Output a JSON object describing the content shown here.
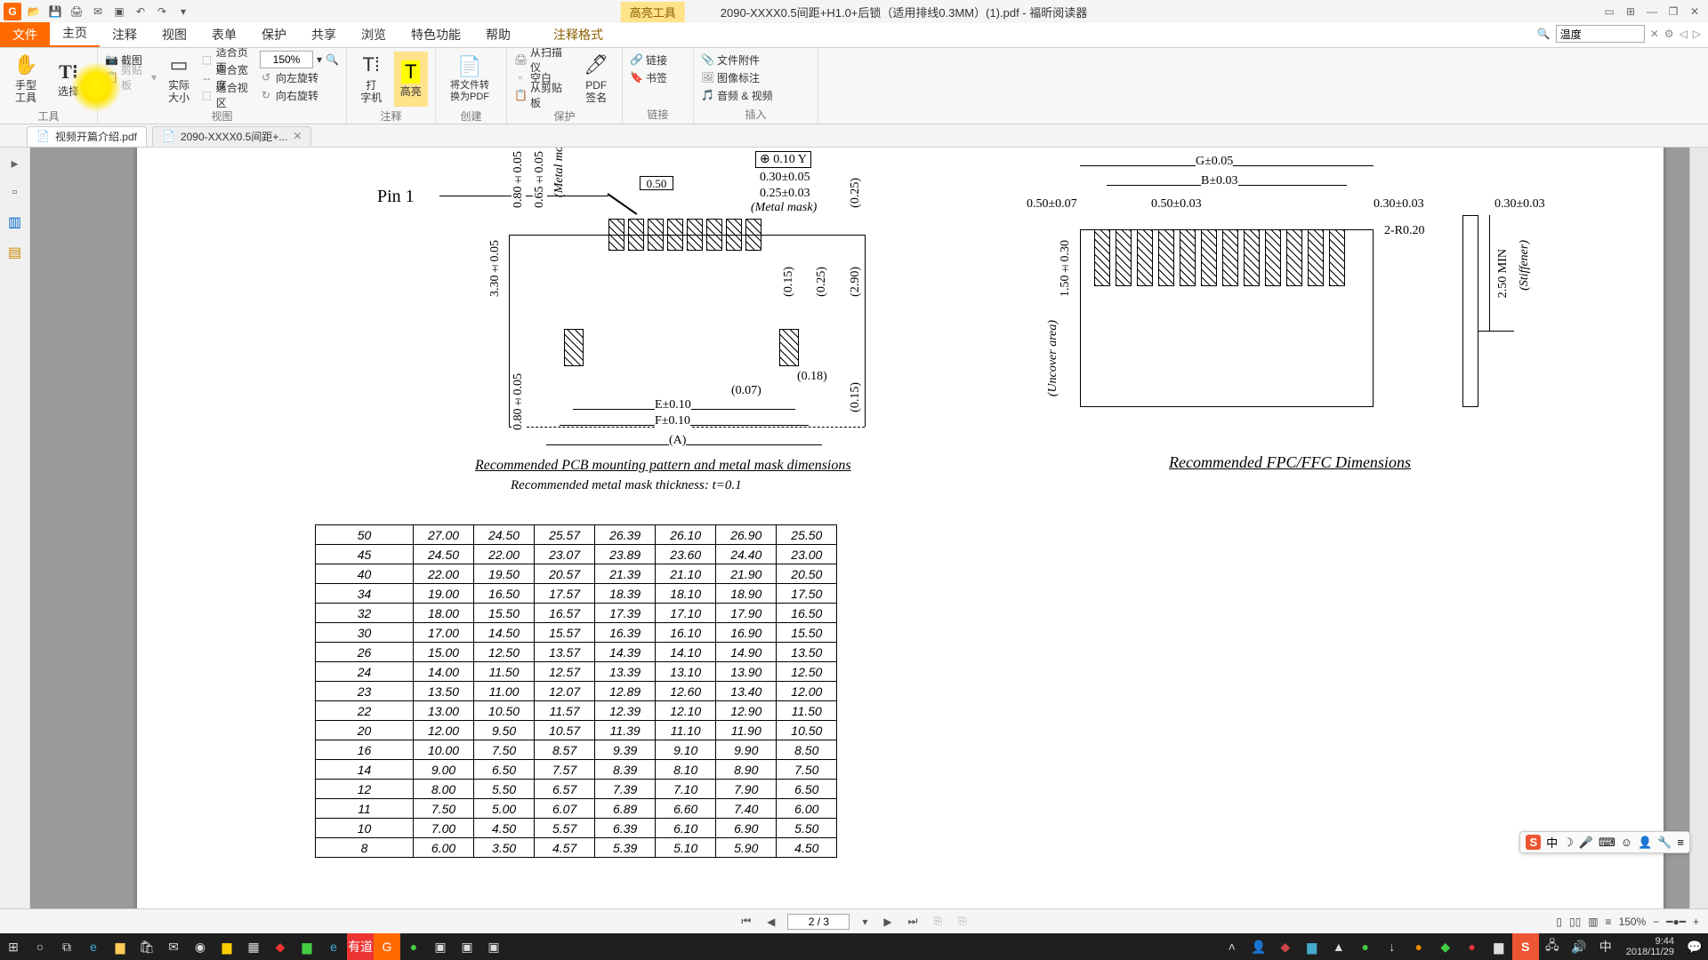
{
  "title": {
    "tool": "高亮工具",
    "doc": "2090-XXXX0.5间距+H1.0+后锁（适用排线0.3MM）(1).pdf - 福昕阅读器"
  },
  "menu": [
    "文件",
    "主页",
    "注释",
    "视图",
    "表单",
    "保护",
    "共享",
    "浏览",
    "特色功能",
    "帮助",
    "注释格式"
  ],
  "search": {
    "placeholder": "温度"
  },
  "ribbon": {
    "tools": {
      "hand": "手型\n工具",
      "select": "选择",
      "group": "工具"
    },
    "clip": {
      "snap": "截图",
      "clipboard": "剪贴板",
      "actual": "实际\n大小"
    },
    "view": {
      "fitpage": "适合页面",
      "fitwidth": "适合宽度",
      "fitview": "适合视区",
      "rotL": "向左旋转",
      "rotR": "向右旋转",
      "zoom": "150%",
      "group": "视图"
    },
    "annot": {
      "typewriter": "打\n字机",
      "highlight": "高亮",
      "group": "注释"
    },
    "create": {
      "convert": "将文件转\n换为PDF",
      "group": "创建"
    },
    "protect": {
      "pdfsign": "PDF\n签名",
      "group": "保护"
    },
    "links": {
      "link": "链接",
      "bookmark": "书签",
      "scan": "从扫描仪",
      "blank": "空白",
      "clip": "从剪贴板",
      "group": "链接"
    },
    "insert": {
      "attach": "文件附件",
      "imgnote": "图像标注",
      "av": "音频 & 视频",
      "group": "插入"
    }
  },
  "doctabs": [
    {
      "label": "视频开篇介绍.pdf"
    },
    {
      "label": "2090-XXXX0.5间距+..."
    }
  ],
  "drawing": {
    "pin1": "Pin 1",
    "d_050": "0.50",
    "d_030_005": "0.30±0.05",
    "d_025_003": "0.25±0.03",
    "metal_mask": "(Metal mask)",
    "metal_mo": "(Metal mo",
    "d_080_005": "0.80±0.05",
    "d_065_005": "0.65±0.05",
    "d_330_005": "3.30±0.05",
    "d_080_005b": "0.80±0.05",
    "d_015": "(0.15)",
    "d_025": "(0.25)",
    "d_290": "(2.90)",
    "d_015b": "(0.15)",
    "d_018": "(0.18)",
    "d_007": "(0.07)",
    "e010": "E±0.10",
    "f010": "F±0.10",
    "a": "(A)",
    "gd": "⊕ 0.10 Y",
    "caption1": "Recommended PCB mounting pattern and metal mask dimensions",
    "caption1b": "Recommended metal mask thickness: t=0.1"
  },
  "drawing2": {
    "g": "G±0.05",
    "b": "B±0.03",
    "d050_007": "0.50±0.07",
    "d050_003": "0.50±0.03",
    "d030_003": "0.30±0.03",
    "d030_003b": "0.30±0.03",
    "r": "2-R0.20",
    "d150": "1.50±0.30",
    "uncover": "(Uncover area)",
    "stiff": "(Stiffener)",
    "d250": "2.50 MIN",
    "caption": "Recommended FPC/FFC Dimensions"
  },
  "table": [
    [
      "50",
      "27.00",
      "24.50",
      "25.57",
      "26.39",
      "26.10",
      "26.90",
      "25.50"
    ],
    [
      "45",
      "24.50",
      "22.00",
      "23.07",
      "23.89",
      "23.60",
      "24.40",
      "23.00"
    ],
    [
      "40",
      "22.00",
      "19.50",
      "20.57",
      "21.39",
      "21.10",
      "21.90",
      "20.50"
    ],
    [
      "34",
      "19.00",
      "16.50",
      "17.57",
      "18.39",
      "18.10",
      "18.90",
      "17.50"
    ],
    [
      "32",
      "18.00",
      "15.50",
      "16.57",
      "17.39",
      "17.10",
      "17.90",
      "16.50"
    ],
    [
      "30",
      "17.00",
      "14.50",
      "15.57",
      "16.39",
      "16.10",
      "16.90",
      "15.50"
    ],
    [
      "26",
      "15.00",
      "12.50",
      "13.57",
      "14.39",
      "14.10",
      "14.90",
      "13.50"
    ],
    [
      "24",
      "14.00",
      "11.50",
      "12.57",
      "13.39",
      "13.10",
      "13.90",
      "12.50"
    ],
    [
      "23",
      "13.50",
      "11.00",
      "12.07",
      "12.89",
      "12.60",
      "13.40",
      "12.00"
    ],
    [
      "22",
      "13.00",
      "10.50",
      "11.57",
      "12.39",
      "12.10",
      "12.90",
      "11.50"
    ],
    [
      "20",
      "12.00",
      "9.50",
      "10.57",
      "11.39",
      "11.10",
      "11.90",
      "10.50"
    ],
    [
      "16",
      "10.00",
      "7.50",
      "8.57",
      "9.39",
      "9.10",
      "9.90",
      "8.50"
    ],
    [
      "14",
      "9.00",
      "6.50",
      "7.57",
      "8.39",
      "8.10",
      "8.90",
      "7.50"
    ],
    [
      "12",
      "8.00",
      "5.50",
      "6.57",
      "7.39",
      "7.10",
      "7.90",
      "6.50"
    ],
    [
      "11",
      "7.50",
      "5.00",
      "6.07",
      "6.89",
      "6.60",
      "7.40",
      "6.00"
    ],
    [
      "10",
      "7.00",
      "4.50",
      "5.57",
      "6.39",
      "6.10",
      "6.90",
      "5.50"
    ],
    [
      "8",
      "6.00",
      "3.50",
      "4.57",
      "5.39",
      "5.10",
      "5.90",
      "4.50"
    ]
  ],
  "status": {
    "page": "2 / 3",
    "zoom": "150%"
  },
  "clock": {
    "time": "9:44",
    "date": "2018/11/29"
  },
  "ime": {
    "s": "S",
    "zh": "中"
  }
}
